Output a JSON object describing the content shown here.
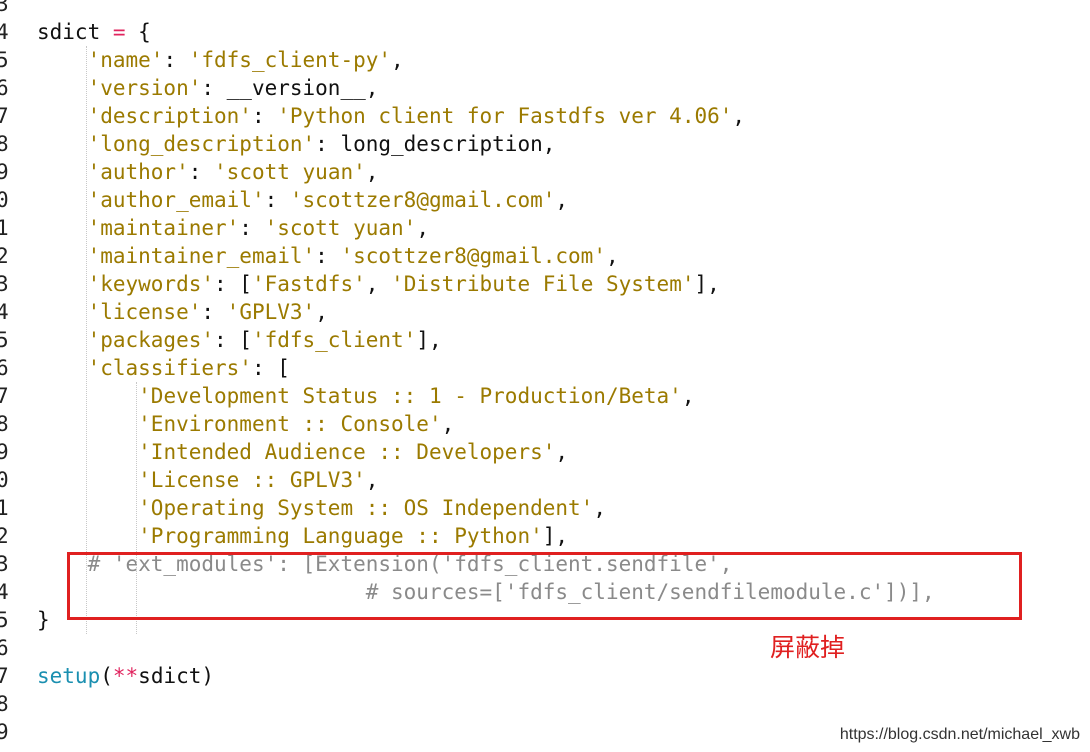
{
  "editor": {
    "lines": [
      {
        "num": "3",
        "tokens": []
      },
      {
        "num": "4",
        "tokens": [
          {
            "t": "sdict ",
            "c": ""
          },
          {
            "t": "=",
            "c": "op"
          },
          {
            "t": " {",
            "c": ""
          }
        ]
      },
      {
        "num": "5",
        "tokens": [
          {
            "t": "    ",
            "c": ""
          },
          {
            "t": "'name'",
            "c": "str"
          },
          {
            "t": ": ",
            "c": ""
          },
          {
            "t": "'fdfs_client-py'",
            "c": "str"
          },
          {
            "t": ",",
            "c": ""
          }
        ]
      },
      {
        "num": "6",
        "tokens": [
          {
            "t": "    ",
            "c": ""
          },
          {
            "t": "'version'",
            "c": "str"
          },
          {
            "t": ": __version__,",
            "c": ""
          }
        ]
      },
      {
        "num": "7",
        "tokens": [
          {
            "t": "    ",
            "c": ""
          },
          {
            "t": "'description'",
            "c": "str"
          },
          {
            "t": ": ",
            "c": ""
          },
          {
            "t": "'Python client for Fastdfs ver 4.06'",
            "c": "str"
          },
          {
            "t": ",",
            "c": ""
          }
        ]
      },
      {
        "num": "8",
        "tokens": [
          {
            "t": "    ",
            "c": ""
          },
          {
            "t": "'long_description'",
            "c": "str"
          },
          {
            "t": ": long_description,",
            "c": ""
          }
        ]
      },
      {
        "num": "9",
        "tokens": [
          {
            "t": "    ",
            "c": ""
          },
          {
            "t": "'author'",
            "c": "str"
          },
          {
            "t": ": ",
            "c": ""
          },
          {
            "t": "'scott yuan'",
            "c": "str"
          },
          {
            "t": ",",
            "c": ""
          }
        ]
      },
      {
        "num": "0",
        "tokens": [
          {
            "t": "    ",
            "c": ""
          },
          {
            "t": "'author_email'",
            "c": "str"
          },
          {
            "t": ": ",
            "c": ""
          },
          {
            "t": "'scottzer8@gmail.com'",
            "c": "str"
          },
          {
            "t": ",",
            "c": ""
          }
        ]
      },
      {
        "num": "1",
        "tokens": [
          {
            "t": "    ",
            "c": ""
          },
          {
            "t": "'maintainer'",
            "c": "str"
          },
          {
            "t": ": ",
            "c": ""
          },
          {
            "t": "'scott yuan'",
            "c": "str"
          },
          {
            "t": ",",
            "c": ""
          }
        ]
      },
      {
        "num": "2",
        "tokens": [
          {
            "t": "    ",
            "c": ""
          },
          {
            "t": "'maintainer_email'",
            "c": "str"
          },
          {
            "t": ": ",
            "c": ""
          },
          {
            "t": "'scottzer8@gmail.com'",
            "c": "str"
          },
          {
            "t": ",",
            "c": ""
          }
        ]
      },
      {
        "num": "3",
        "tokens": [
          {
            "t": "    ",
            "c": ""
          },
          {
            "t": "'keywords'",
            "c": "str"
          },
          {
            "t": ": [",
            "c": ""
          },
          {
            "t": "'Fastdfs'",
            "c": "str"
          },
          {
            "t": ", ",
            "c": ""
          },
          {
            "t": "'Distribute File System'",
            "c": "str"
          },
          {
            "t": "],",
            "c": ""
          }
        ]
      },
      {
        "num": "4",
        "tokens": [
          {
            "t": "    ",
            "c": ""
          },
          {
            "t": "'license'",
            "c": "str"
          },
          {
            "t": ": ",
            "c": ""
          },
          {
            "t": "'GPLV3'",
            "c": "str"
          },
          {
            "t": ",",
            "c": ""
          }
        ]
      },
      {
        "num": "5",
        "tokens": [
          {
            "t": "    ",
            "c": ""
          },
          {
            "t": "'packages'",
            "c": "str"
          },
          {
            "t": ": [",
            "c": ""
          },
          {
            "t": "'fdfs_client'",
            "c": "str"
          },
          {
            "t": "],",
            "c": ""
          }
        ]
      },
      {
        "num": "6",
        "tokens": [
          {
            "t": "    ",
            "c": ""
          },
          {
            "t": "'classifiers'",
            "c": "str"
          },
          {
            "t": ": [",
            "c": ""
          }
        ]
      },
      {
        "num": "7",
        "tokens": [
          {
            "t": "        ",
            "c": ""
          },
          {
            "t": "'Development Status :: 1 - Production/Beta'",
            "c": "str"
          },
          {
            "t": ",",
            "c": ""
          }
        ]
      },
      {
        "num": "8",
        "tokens": [
          {
            "t": "        ",
            "c": ""
          },
          {
            "t": "'Environment :: Console'",
            "c": "str"
          },
          {
            "t": ",",
            "c": ""
          }
        ]
      },
      {
        "num": "9",
        "tokens": [
          {
            "t": "        ",
            "c": ""
          },
          {
            "t": "'Intended Audience :: Developers'",
            "c": "str"
          },
          {
            "t": ",",
            "c": ""
          }
        ]
      },
      {
        "num": "0",
        "tokens": [
          {
            "t": "        ",
            "c": ""
          },
          {
            "t": "'License :: GPLV3'",
            "c": "str"
          },
          {
            "t": ",",
            "c": ""
          }
        ]
      },
      {
        "num": "1",
        "tokens": [
          {
            "t": "        ",
            "c": ""
          },
          {
            "t": "'Operating System :: OS Independent'",
            "c": "str"
          },
          {
            "t": ",",
            "c": ""
          }
        ]
      },
      {
        "num": "2",
        "tokens": [
          {
            "t": "        ",
            "c": ""
          },
          {
            "t": "'Programming Language :: Python'",
            "c": "str"
          },
          {
            "t": "],",
            "c": ""
          }
        ]
      },
      {
        "num": "3",
        "tokens": [
          {
            "t": "    ",
            "c": ""
          },
          {
            "t": "# 'ext_modules': [Extension('fdfs_client.sendfile',",
            "c": "cm"
          }
        ]
      },
      {
        "num": "4",
        "tokens": [
          {
            "t": "                          ",
            "c": ""
          },
          {
            "t": "# sources=['fdfs_client/sendfilemodule.c'])],",
            "c": "cm"
          }
        ]
      },
      {
        "num": "5",
        "tokens": [
          {
            "t": "}",
            "c": ""
          }
        ]
      },
      {
        "num": "6",
        "tokens": []
      },
      {
        "num": "7",
        "tokens": [
          {
            "t": "setup",
            "c": "fn"
          },
          {
            "t": "(",
            "c": ""
          },
          {
            "t": "**",
            "c": "op"
          },
          {
            "t": "sdict)",
            "c": ""
          }
        ]
      },
      {
        "num": "8",
        "tokens": []
      },
      {
        "num": "9",
        "tokens": []
      }
    ]
  },
  "annotation": {
    "text": "屏蔽掉"
  },
  "watermark": {
    "text": "https://blog.csdn.net/michael_xwb"
  }
}
